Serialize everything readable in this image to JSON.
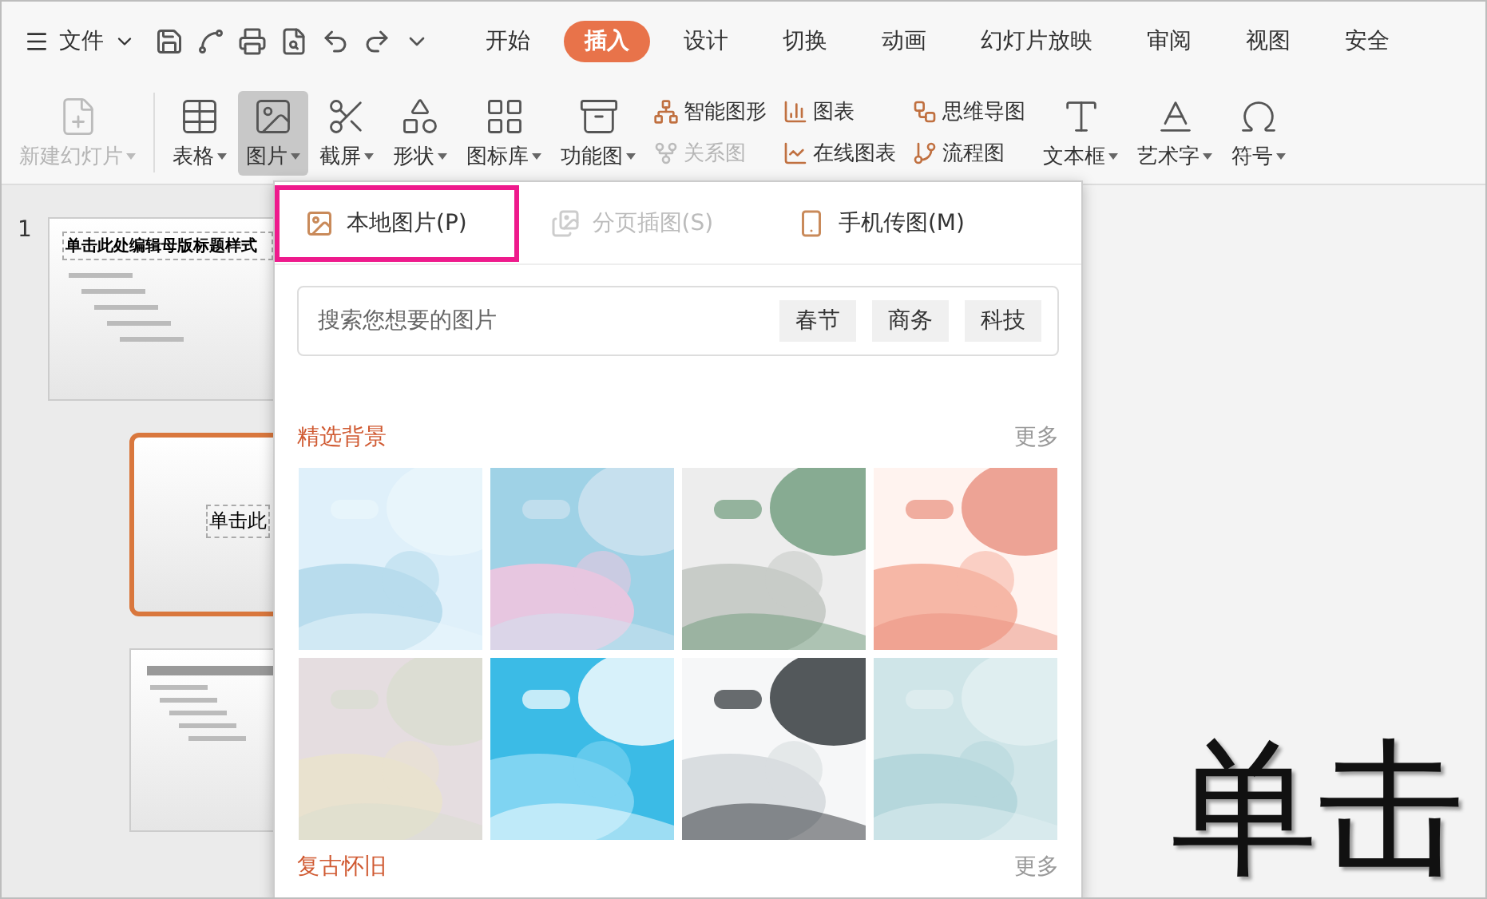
{
  "menu": {
    "file": "文件",
    "tabs": [
      {
        "label": "开始",
        "selected": false
      },
      {
        "label": "插入",
        "selected": true
      },
      {
        "label": "设计",
        "selected": false
      },
      {
        "label": "切换",
        "selected": false
      },
      {
        "label": "动画",
        "selected": false
      },
      {
        "label": "幻灯片放映",
        "selected": false
      },
      {
        "label": "审阅",
        "selected": false
      },
      {
        "label": "视图",
        "selected": false
      },
      {
        "label": "安全",
        "selected": false
      }
    ]
  },
  "ribbon": [
    {
      "kind": "large",
      "label": "新建幻灯片",
      "disabled": true,
      "selected": false
    },
    {
      "kind": "large",
      "label": "表格",
      "disabled": false,
      "selected": false
    },
    {
      "kind": "large",
      "label": "图片",
      "disabled": false,
      "selected": true
    },
    {
      "kind": "large",
      "label": "截屏",
      "disabled": false,
      "selected": false
    },
    {
      "kind": "large",
      "label": "形状",
      "disabled": false,
      "selected": false
    },
    {
      "kind": "large",
      "label": "图标库",
      "disabled": false,
      "selected": false
    },
    {
      "kind": "large",
      "label": "功能图",
      "disabled": false,
      "selected": false
    },
    {
      "kind": "stack",
      "items": [
        {
          "label": "智能图形",
          "disabled": false
        },
        {
          "label": "关系图",
          "disabled": true
        }
      ]
    },
    {
      "kind": "stack",
      "items": [
        {
          "label": "图表",
          "disabled": false
        },
        {
          "label": "在线图表",
          "disabled": false
        }
      ]
    },
    {
      "kind": "stack",
      "items": [
        {
          "label": "思维导图",
          "disabled": false
        },
        {
          "label": "流程图",
          "disabled": false
        }
      ]
    },
    {
      "kind": "large",
      "label": "文本框",
      "disabled": false,
      "selected": false
    },
    {
      "kind": "large",
      "label": "艺术字",
      "disabled": false,
      "selected": false
    },
    {
      "kind": "large",
      "label": "符号",
      "disabled": false,
      "selected": false
    }
  ],
  "slides": [
    {
      "kind": "master",
      "number": "1",
      "title": "单击此处编辑母版标题样式",
      "selected": false
    },
    {
      "kind": "layout",
      "title": "单击此",
      "selected": true
    },
    {
      "kind": "layout",
      "selected": false
    }
  ],
  "canvas": {
    "title": "单击"
  },
  "picture_menu": {
    "sources": [
      {
        "label": "本地图片(P)",
        "disabled": false,
        "highlighted": true
      },
      {
        "label": "分页插图(S)",
        "disabled": true,
        "highlighted": false
      },
      {
        "label": "手机传图(M)",
        "disabled": false,
        "highlighted": false
      }
    ],
    "search": {
      "placeholder": "搜索您想要的图片",
      "tags": [
        "春节",
        "商务",
        "科技"
      ]
    },
    "sections": [
      {
        "title": "精选背景",
        "more": "更多"
      },
      {
        "title": "复古怀旧",
        "more": "更多"
      }
    ]
  }
}
